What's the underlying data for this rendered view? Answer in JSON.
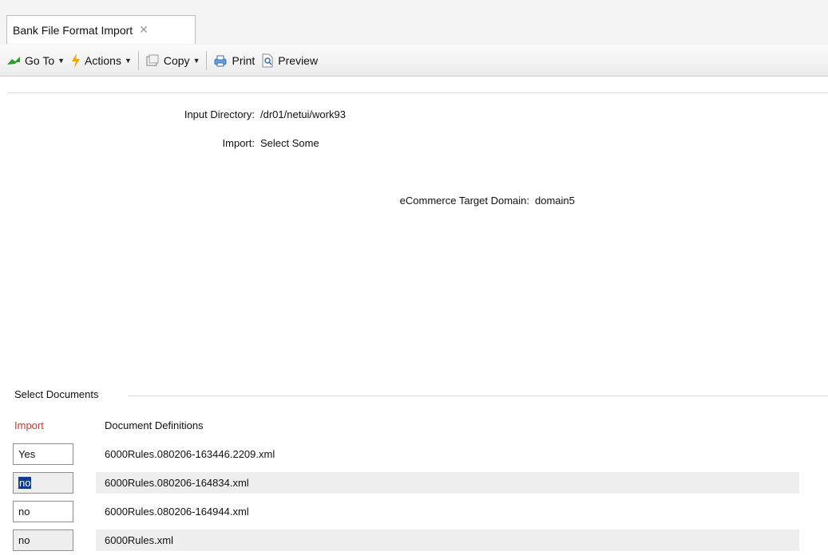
{
  "tab": {
    "title": "Bank File Format Import",
    "close_glyph": "✕"
  },
  "toolbar": {
    "goto": "Go To",
    "actions": "Actions",
    "copy": "Copy",
    "print": "Print",
    "preview": "Preview"
  },
  "form": {
    "input_directory_label": "Input Directory:",
    "input_directory_value": "/dr01/netui/work93",
    "import_label": "Import:",
    "import_value": "Select Some",
    "ecommerce_label": "eCommerce Target Domain:",
    "ecommerce_value": "domain5"
  },
  "documents": {
    "section_title": "Select Documents",
    "col_import": "Import",
    "col_definitions": "Document Definitions",
    "rows": [
      {
        "import": "Yes",
        "definition": "6000Rules.080206-163446.2209.xml"
      },
      {
        "import": "no",
        "definition": "6000Rules.080206-164834.xml"
      },
      {
        "import": "no",
        "definition": "6000Rules.080206-164944.xml"
      },
      {
        "import": "no",
        "definition": "6000Rules.xml"
      }
    ]
  },
  "colors": {
    "import_header": "#d0322e",
    "selection": "#123b8c"
  }
}
